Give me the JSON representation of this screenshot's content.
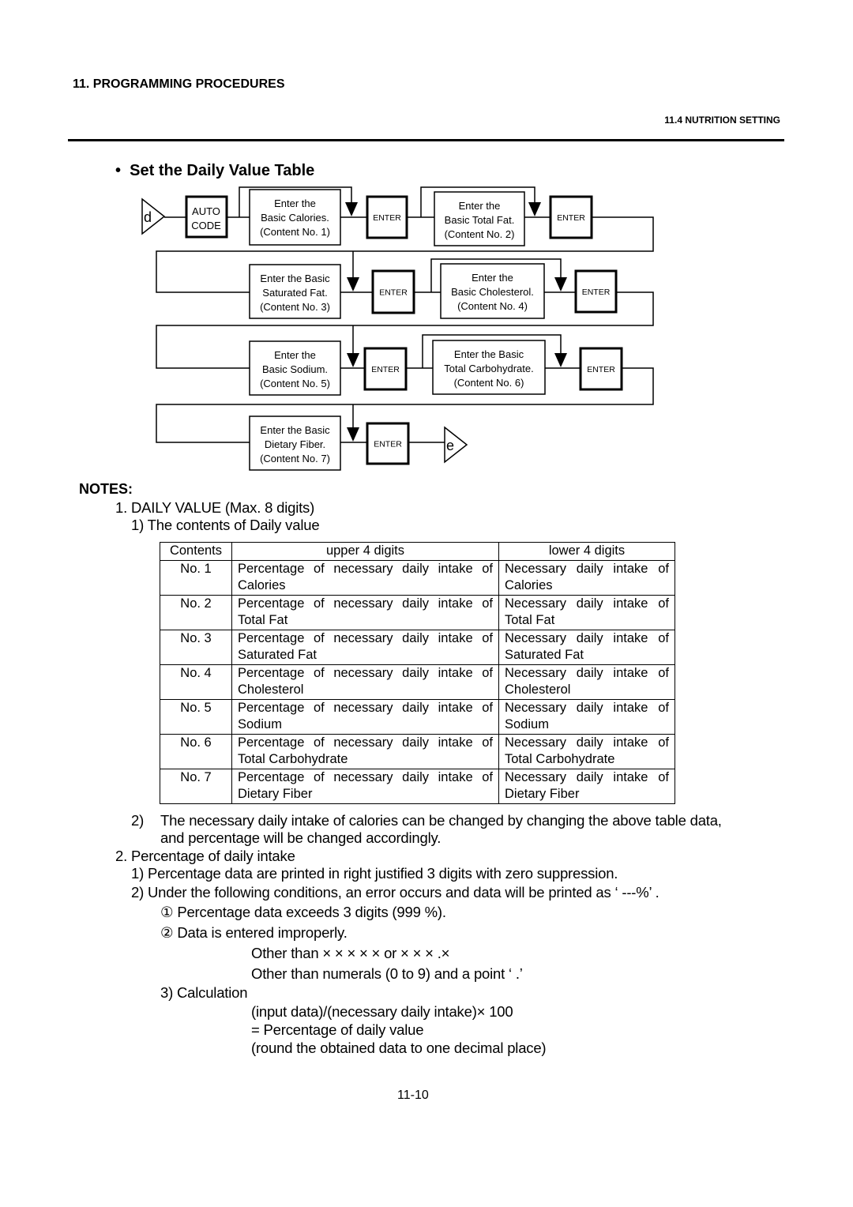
{
  "header": {
    "chapter": "11.  PROGRAMMING PROCEDURES",
    "section": "11.4 NUTRITION SETTING"
  },
  "title": {
    "bullet": "•",
    "text": "Set the Daily Value Table"
  },
  "flowchart": {
    "start": "d",
    "end": "e",
    "auto_code": [
      "AUTO",
      "CODE"
    ],
    "enter": "ENTER",
    "steps": [
      [
        "Enter the",
        "Basic Calories.",
        "(Content No. 1)"
      ],
      [
        "Enter the",
        "Basic Total Fat.",
        "(Content No. 2)"
      ],
      [
        "Enter the Basic",
        "Saturated Fat.",
        "(Content No. 3)"
      ],
      [
        "Enter the",
        "Basic Cholesterol.",
        "(Content No. 4)"
      ],
      [
        "Enter the",
        "Basic Sodium.",
        "(Content No. 5)"
      ],
      [
        "Enter the Basic",
        "Total Carbohydrate.",
        "(Content No. 6)"
      ],
      [
        "Enter the Basic",
        "Dietary Fiber.",
        "(Content No. 7)"
      ]
    ]
  },
  "notes": {
    "heading": "NOTES:",
    "n1": "1.  DAILY VALUE (Max. 8 digits)",
    "n1_1": "1)   The contents of Daily value",
    "table": {
      "headers": [
        "Contents",
        "upper 4 digits",
        "lower 4 digits"
      ],
      "rows": [
        [
          "No. 1",
          "Percentage of necessary daily intake of Calories",
          "Necessary daily intake of Calories"
        ],
        [
          "No. 2",
          "Percentage of necessary daily intake of Total Fat",
          "Necessary daily intake of Total Fat"
        ],
        [
          "No. 3",
          "Percentage of necessary daily intake of Saturated Fat",
          "Necessary daily intake of Saturated Fat"
        ],
        [
          "No. 4",
          "Percentage of necessary daily intake of Cholesterol",
          "Necessary daily intake of Cholesterol"
        ],
        [
          "No. 5",
          "Percentage of necessary daily intake of Sodium",
          "Necessary daily intake of Sodium"
        ],
        [
          "No. 6",
          "Percentage of necessary daily intake of Total Carbohydrate",
          "Necessary daily intake of Total Carbohydrate"
        ],
        [
          "No. 7",
          "Percentage of necessary daily intake of Dietary Fiber",
          "Necessary daily intake of Dietary Fiber"
        ]
      ]
    },
    "n1_2_num": "2)",
    "n1_2_a": "The necessary daily intake of calories can be changed by changing the above table data,",
    "n1_2_b": "and percentage will be changed accordingly.",
    "n2": "2.  Percentage of daily intake",
    "n2_1": "1)   Percentage data are printed in right justified 3 digits with zero suppression.",
    "n2_2": "2)   Under the following conditions, an error occurs and data will be printed as ‘  ---%’ .",
    "c1": "①   Percentage data exceeds 3 digits (999 %).",
    "c2": "②   Data is entered improperly.",
    "c2_a": "Other than × × × × ×   or × × × .×",
    "c2_b": "Other than numerals (0 to 9) and a point ‘  .’",
    "n2_3": "3)    Calculation",
    "calc1": "(input data)/(necessary daily intake)×  100",
    "calc2": "= Percentage of daily value",
    "calc3": "(round the obtained data to one decimal place)"
  },
  "footer": {
    "page": "11-10"
  }
}
